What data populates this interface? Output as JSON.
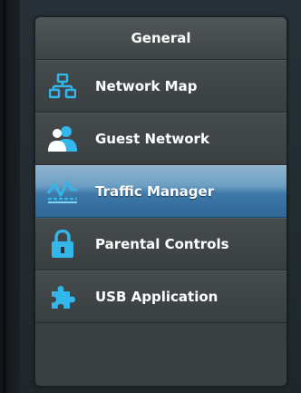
{
  "menu": {
    "header": "General",
    "items": [
      {
        "label": "Network Map",
        "icon": "network-map-icon",
        "active": false
      },
      {
        "label": "Guest Network",
        "icon": "guest-network-icon",
        "active": false
      },
      {
        "label": "Traffic Manager",
        "icon": "traffic-manager-icon",
        "active": true
      },
      {
        "label": "Parental Controls",
        "icon": "lock-icon",
        "active": false
      },
      {
        "label": "USB Application",
        "icon": "puzzle-icon",
        "active": false
      }
    ]
  },
  "colors": {
    "icon_accent": "#33b6ea",
    "active_item": "#3d78a8"
  }
}
